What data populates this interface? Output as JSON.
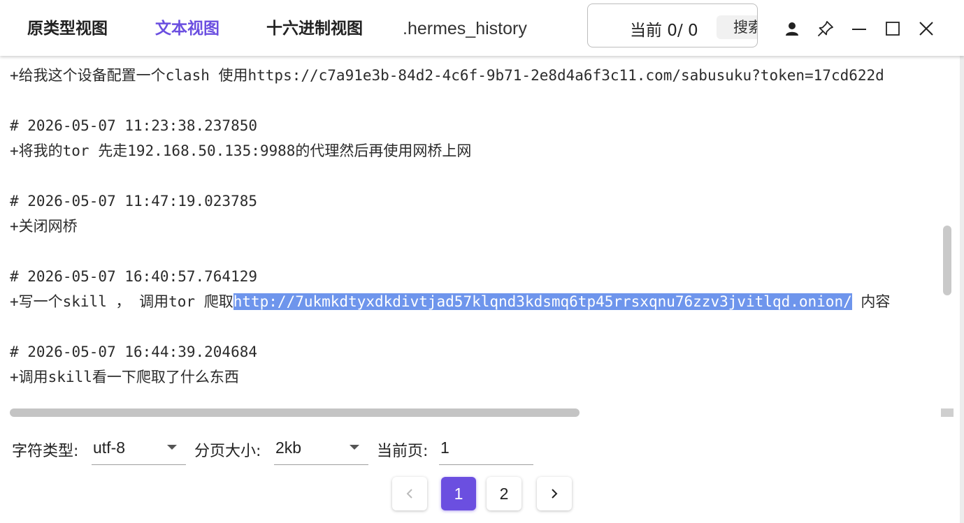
{
  "header": {
    "tabs": [
      {
        "label": "原类型视图"
      },
      {
        "label": "文本视图"
      },
      {
        "label": "十六进制视图"
      }
    ],
    "file_name": ".hermes_history",
    "search": {
      "counter": "当前  0/  0",
      "button_label": "搜索"
    },
    "accent_color": "#6b4fe0"
  },
  "window_controls": [
    "user-icon",
    "pin-icon",
    "minimize-icon",
    "maximize-icon",
    "close-icon"
  ],
  "content": {
    "lines": [
      "+给我这个设备配置一个clash 使用https://c7a91e3b-84d2-4c6f-9b71-2e8d4a6f3c11.com/sabusuku?token=17cd622d",
      "# 2026-05-07 11:23:38.237850",
      "+将我的tor 先走192.168.50.135:9988的代理然后再使用网桥上网",
      "# 2026-05-07 11:47:19.023785",
      "+关闭网桥",
      "# 2026-05-07 16:40:57.764129",
      "# 2026-05-07 16:44:39.204684",
      "+调用skill看一下爬取了什么东西"
    ],
    "selected_line": {
      "prefix": "+写一个skill ， 调用tor 爬取",
      "highlight": "http://7ukmkdtyxdkdivtjad57klqnd3kdsmq6tp45rrsxqnu76zzv3jvitlqd.onion/",
      "suffix": " 内容"
    },
    "highlight_color": "#6e95ec"
  },
  "footer": {
    "charset_label": "字符类型:",
    "charset_value": "utf-8",
    "pagesize_label": "分页大小:",
    "pagesize_value": "2kb",
    "page_label": "当前页:",
    "page_value": "1",
    "pages": [
      "1",
      "2"
    ],
    "prev_icon": "chevron-left-icon",
    "next_icon": "chevron-right-icon"
  }
}
